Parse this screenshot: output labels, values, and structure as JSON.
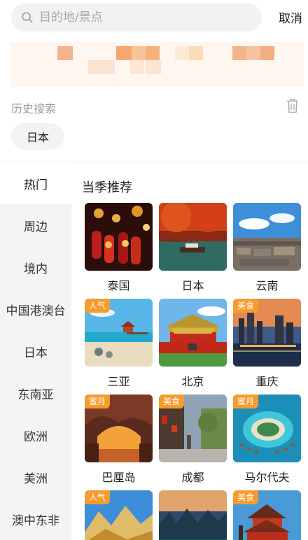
{
  "search": {
    "placeholder": "目的地/景点",
    "cancel_label": "取消"
  },
  "history": {
    "title": "历史搜索",
    "items": [
      "日本"
    ]
  },
  "nav": {
    "active": "热门",
    "items": [
      "热门",
      "周边",
      "境内",
      "中国港澳台",
      "日本",
      "东南亚",
      "欧洲",
      "美洲",
      "澳中东非"
    ]
  },
  "section": {
    "title": "当季推荐"
  },
  "destinations": [
    {
      "name": "泰国",
      "tag": ""
    },
    {
      "name": "日本",
      "tag": ""
    },
    {
      "name": "云南",
      "tag": ""
    },
    {
      "name": "三亚",
      "tag": "人气"
    },
    {
      "name": "北京",
      "tag": ""
    },
    {
      "name": "重庆",
      "tag": "美食"
    },
    {
      "name": "巴厘岛",
      "tag": "蜜月"
    },
    {
      "name": "成都",
      "tag": "美食"
    },
    {
      "name": "马尔代夫",
      "tag": "蜜月"
    },
    {
      "name": "",
      "tag": "人气"
    },
    {
      "name": "",
      "tag": ""
    },
    {
      "name": "",
      "tag": "美食"
    }
  ],
  "colors": {
    "accent_tag": "#f79b2e",
    "nav_bg": "#f4f4f4",
    "banner_bg": "#fff6ef"
  },
  "icons": {
    "search": "search-icon",
    "trash": "trash-icon"
  }
}
